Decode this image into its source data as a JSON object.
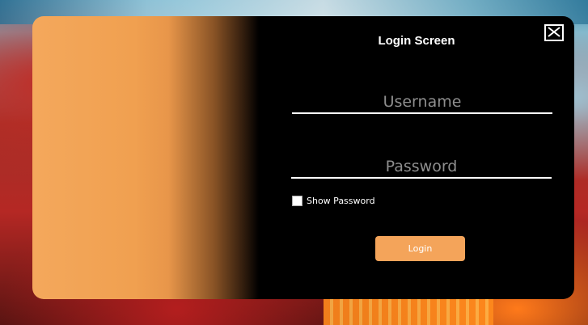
{
  "window": {
    "title": "Login Screen"
  },
  "form": {
    "username_placeholder": "Username",
    "username_value": "",
    "password_placeholder": "Password",
    "password_value": "",
    "show_password_label": "Show Password",
    "show_password_checked": false,
    "login_label": "Login"
  },
  "icons": {
    "close": "close-icon"
  },
  "colors": {
    "accent": "#f4a45a",
    "panel": "#000000",
    "gradient_start": "#f4a85c"
  }
}
